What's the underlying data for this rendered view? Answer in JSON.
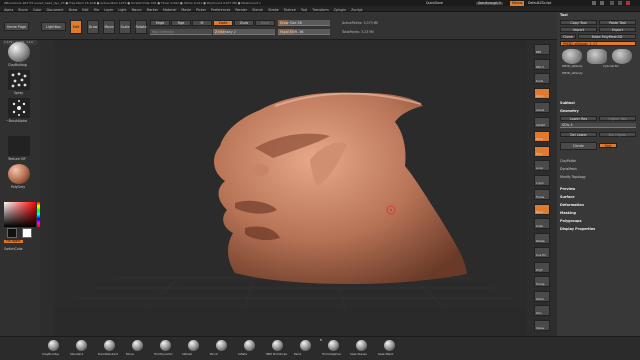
{
  "titlebar": {
    "left": "ZBrushCore 4R7 P3   sculpt_head_dyn_23   ● Free Mem 15.1GB ● Active Mem 1472 ● Scratch Disk 434 ● Timer 0.002 ● ATime 0.011 ● PolyCount 4.077 MP ● MeshCount 1",
    "quicksave": "QuickSave",
    "see_through": "See-through  0",
    "menus_btn": "Menus",
    "script": "DefaultZScript"
  },
  "menubar": [
    "Alpha",
    "Brush",
    "Color",
    "Document",
    "Draw",
    "Edit",
    "File",
    "Layer",
    "Light",
    "Macro",
    "Marker",
    "Material",
    "Movie",
    "Picker",
    "Preferences",
    "Render",
    "Stencil",
    "Stroke",
    "Texture",
    "Tool",
    "Transform",
    "Zplugin",
    "Zscript"
  ],
  "shelf": {
    "home_page": "Home Page",
    "lightbox": "LightBox",
    "edit": "Edit",
    "draw": "Draw",
    "move": "Move",
    "scale": "Scale",
    "rotate": "Rotate",
    "mrgb": "Mrgb",
    "rgb": "Rgb",
    "m": "M",
    "zadd": "Zadd",
    "zsub": "Zsub",
    "zcut": "Zcut",
    "rgb_intensity": "Rgb Intensity",
    "z_intensity": "Z Intensity  2",
    "focal_shift": "Focal Shift  -56",
    "draw_size": "Draw Size  56",
    "active_points": "ActivePoints: 3.073 Mil",
    "total_points": "TotalPoints: 3.23 Mil"
  },
  "coords": "1.172, -0.166, 1.13",
  "leftpanel": {
    "brush": "ClayBuildup",
    "stroke": "Spray",
    "alpha": "~BrushAlpha",
    "texture": "Texture Off",
    "material": "PolyGrey",
    "gradient": "Gradient",
    "switch_color": "SwitchColor",
    "alternate": "Alternate",
    "fill_object": "FillObject"
  },
  "right_strip": [
    "BPR",
    "SPix 3",
    "Scroll",
    "Zoom",
    "Actual",
    "AAHalf",
    "Persp",
    "Floor",
    "Local",
    "L.Sym",
    "Frame",
    "Move",
    "Scale",
    "Rotate",
    "Line Fill",
    "PolyF",
    "Transp",
    "Ghost",
    "Solo",
    "Xpose"
  ],
  "tool": {
    "title": "Tool",
    "load_tool": "Load Tool",
    "save_as": "Save As",
    "copy_tool": "Copy Tool",
    "paste_tool": "Paste Tool",
    "import": "Import",
    "export": "Export",
    "clone": "Clone",
    "make_polymesh": "Make PolyMesh3D",
    "goz": "GoZ",
    "all": "All",
    "visible": "Visible",
    "r": "R",
    "current": "PM3D_sktbody_1",
    "count": "17",
    "thumbs": [
      "PM3D_sktbody",
      "Cylinder3D",
      "PM3D_sktbody"
    ],
    "subtool": "Subtool",
    "geometry": "Geometry",
    "lower_res": "Lower Res",
    "higher_res": "Higher Res",
    "sdiv": "SDiv  4",
    "del_lower": "Del Lower",
    "del_higher": "Del Higher",
    "divide": "Divide",
    "smt": "Smt",
    "clay_polish": "ClayPolish",
    "dynamesh": "DynaMesh",
    "modify_topology": "Modify Topology",
    "sections": [
      "Preview",
      "Surface",
      "Deformation",
      "Masking",
      "Polygroups",
      "Display Properties"
    ]
  },
  "bottom_brushes": [
    "ClayBuildup",
    "Standard",
    "DamStandard",
    "Move",
    "TrimDynamic",
    "hPolish",
    "Pinch",
    "Inflate",
    "IMM Primitives",
    "Paint",
    "TrimAdaptive",
    "SelectLasso",
    "SelectRect"
  ],
  "bottom_badge": "5"
}
